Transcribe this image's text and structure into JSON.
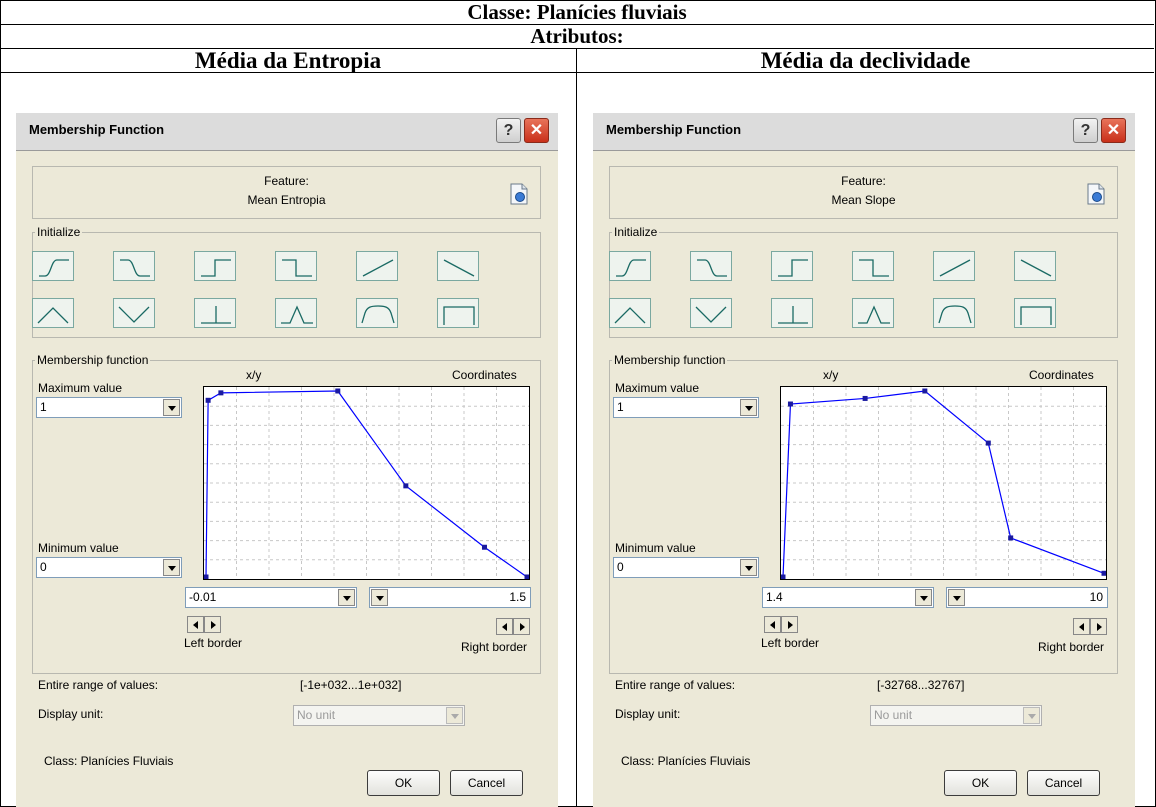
{
  "header": {
    "class_title": "Classe: Planícies fluviais",
    "attributes_title": "Atributos:"
  },
  "panels": [
    {
      "column_title": "Média da Entropia",
      "dialog": {
        "title": "Membership Function",
        "help_label": "?",
        "close_label": "✕",
        "feature_caption": "Feature:",
        "feature_name": "Mean Entropia",
        "initialize_label": "Initialize",
        "shape_icons": [
          "larger-s-curve-icon",
          "smaller-s-curve-icon",
          "larger-step-icon",
          "smaller-step-icon",
          "linear-increase-icon",
          "linear-decrease-icon",
          "triangle-icon",
          "inverted-triangle-icon",
          "single-value-icon",
          "gaussian-icon",
          "about-range-icon",
          "full-range-icon"
        ],
        "membership_label": "Membership function",
        "xy_label": "x/y",
        "coordinates_label": "Coordinates",
        "maximum_label": "Maximum value",
        "maximum_value": "1",
        "minimum_label": "Minimum value",
        "minimum_value": "0",
        "left_border_value": "-0.01",
        "right_border_value": "1.5",
        "left_border_label": "Left border",
        "right_border_label": "Right border",
        "entire_range_label": "Entire range of values:",
        "entire_range_value": "[-1e+032...1e+032]",
        "display_unit_label": "Display unit:",
        "display_unit_value": "No unit",
        "class_label": "Class: Planícies Fluviais",
        "ok_label": "OK",
        "cancel_label": "Cancel",
        "curve": {
          "color": "#0000ff",
          "x_range": [
            -0.01,
            1.5
          ],
          "y_range": [
            0,
            1
          ],
          "points": [
            [
              -0.01,
              0
            ],
            [
              0.0,
              0.95
            ],
            [
              0.06,
              0.99
            ],
            [
              0.61,
              1.0
            ],
            [
              0.93,
              0.49
            ],
            [
              1.3,
              0.16
            ],
            [
              1.5,
              0.0
            ]
          ]
        }
      }
    },
    {
      "column_title": "Média da declividade",
      "dialog": {
        "title": "Membership Function",
        "help_label": "?",
        "close_label": "✕",
        "feature_caption": "Feature:",
        "feature_name": "Mean Slope",
        "initialize_label": "Initialize",
        "shape_icons": [
          "larger-s-curve-icon",
          "smaller-s-curve-icon",
          "larger-step-icon",
          "smaller-step-icon",
          "linear-increase-icon",
          "linear-decrease-icon",
          "triangle-icon",
          "inverted-triangle-icon",
          "single-value-icon",
          "gaussian-icon",
          "about-range-icon",
          "full-range-icon"
        ],
        "membership_label": "Membership function",
        "xy_label": "x/y",
        "coordinates_label": "Coordinates",
        "maximum_label": "Maximum value",
        "maximum_value": "1",
        "minimum_label": "Minimum value",
        "minimum_value": "0",
        "left_border_value": "1.4",
        "right_border_value": "10",
        "left_border_label": "Left border",
        "right_border_label": "Right border",
        "entire_range_label": "Entire range of values:",
        "entire_range_value": "[-32768...32767]",
        "display_unit_label": "Display unit:",
        "display_unit_value": "No unit",
        "class_label": "Class: Planícies Fluviais",
        "ok_label": "OK",
        "cancel_label": "Cancel",
        "curve": {
          "color": "#0000ff",
          "x_range": [
            1.4,
            10
          ],
          "y_range": [
            0,
            1
          ],
          "points": [
            [
              1.4,
              0
            ],
            [
              1.6,
              0.93
            ],
            [
              3.6,
              0.96
            ],
            [
              5.2,
              1.0
            ],
            [
              6.9,
              0.72
            ],
            [
              7.5,
              0.21
            ],
            [
              10,
              0.02
            ]
          ]
        }
      }
    }
  ]
}
